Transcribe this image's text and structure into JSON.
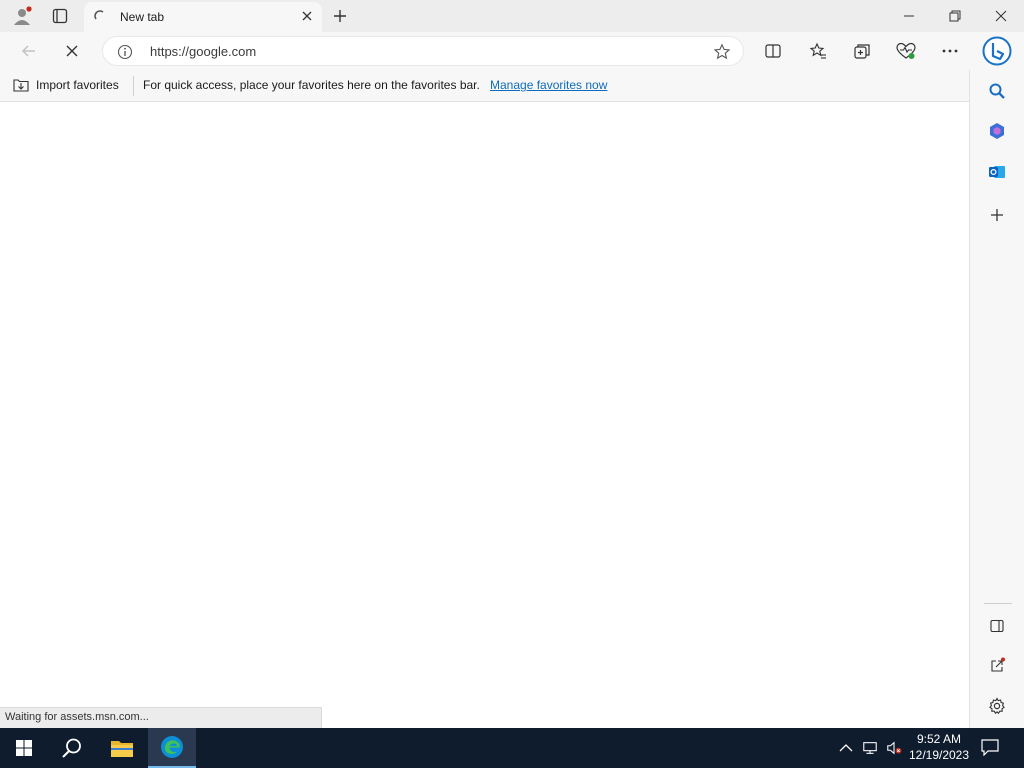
{
  "tab": {
    "title": "New tab"
  },
  "address": {
    "url": "https://google.com"
  },
  "favorites_bar": {
    "import_label": "Import favorites",
    "message": "For quick access, place your favorites here on the favorites bar.",
    "manage_link": "Manage favorites now"
  },
  "status": {
    "text": "Waiting for assets.msn.com..."
  },
  "clock": {
    "time": "9:52 AM",
    "date": "12/19/2023"
  },
  "colors": {
    "link": "#0f6cbd",
    "taskbar": "#0f1c2e",
    "edge_brand": "#0c8fd6"
  }
}
